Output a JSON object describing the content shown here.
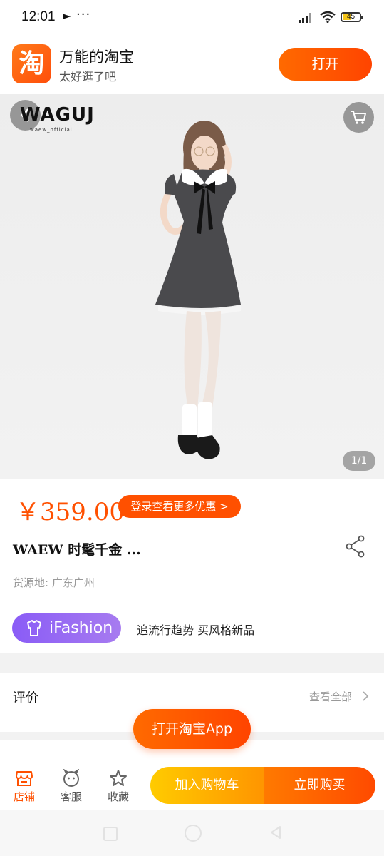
{
  "status_bar": {
    "time": "12:01",
    "battery": "45"
  },
  "app_banner": {
    "app_name": "万能的淘宝",
    "app_sub": "太好逛了吧",
    "open_label": "打开",
    "logo_char": "淘"
  },
  "hero": {
    "brand": "WAGUJ",
    "brand_sub": "waew_official",
    "counter": "1/1"
  },
  "product": {
    "price": "￥359.00",
    "promo": "登录查看更多优惠 >",
    "title": "WAEW 时髦千金 ...",
    "origin": "货源地: 广东广州",
    "ifashion_label": "iFashion",
    "slogan": "追流行趋势 买风格新品"
  },
  "review": {
    "title": "评价",
    "view_all": "查看全部"
  },
  "float_button": "打开淘宝App",
  "bottom_bar": {
    "store": "店铺",
    "service": "客服",
    "favorite": "收藏",
    "add_to_cart": "加入购物车",
    "buy_now": "立即购买"
  },
  "colors": {
    "accent": "#ff5000",
    "ifashion": "#8a5cf6",
    "cart_yellow": "#ffb300"
  }
}
